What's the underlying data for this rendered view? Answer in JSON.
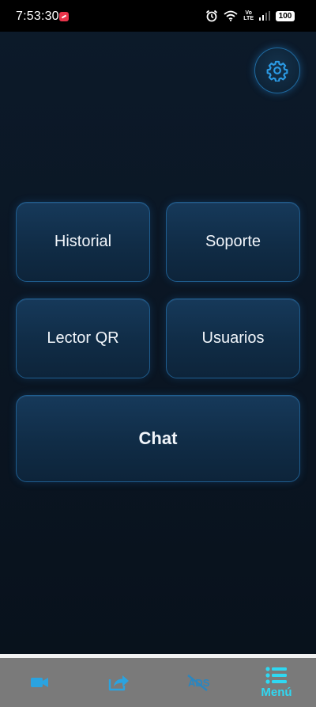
{
  "status_bar": {
    "time": "7:53:30",
    "volte_top": "Vo",
    "volte_bottom": "LTE",
    "battery": "100"
  },
  "settings": {
    "icon": "gear-icon",
    "accent": "#2b9be6"
  },
  "menu": {
    "historial": "Historial",
    "soporte": "Soporte",
    "lector_qr": "Lector QR",
    "usuarios": "Usuarios",
    "chat": "Chat"
  },
  "bottom_nav": {
    "items": [
      {
        "icon": "video-camera-icon"
      },
      {
        "icon": "share-icon"
      },
      {
        "icon": "no-ads-icon"
      },
      {
        "icon": "list-menu-icon",
        "label": "Menú",
        "active": true
      }
    ],
    "accent": "#2fd8f2",
    "background": "#7a7a7a"
  }
}
